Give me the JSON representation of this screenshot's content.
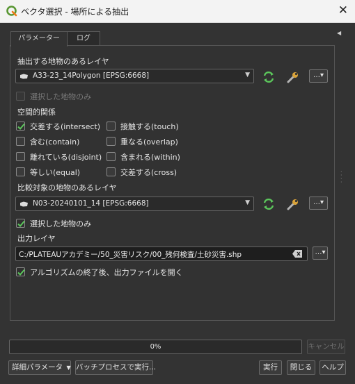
{
  "window": {
    "title": "ベクタ選択 - 場所による抽出",
    "close_glyph": "✕"
  },
  "tabs": [
    {
      "label": "パラメーター"
    },
    {
      "label": "ログ"
    }
  ],
  "params": {
    "input_layer_label": "抽出する地物のあるレイヤ",
    "input_layer_value": "A33-23_14Polygon [EPSG:6668]",
    "input_selected_only": "選択した地物のみ",
    "predicate_label": "空間的関係",
    "predicates": [
      {
        "label": "交差する(intersect)",
        "checked": true
      },
      {
        "label": "接触する(touch)",
        "checked": false
      },
      {
        "label": "含む(contain)",
        "checked": false
      },
      {
        "label": "重なる(overlap)",
        "checked": false
      },
      {
        "label": "離れている(disjoint)",
        "checked": false
      },
      {
        "label": "含まれる(within)",
        "checked": false
      },
      {
        "label": "等しい(equal)",
        "checked": false
      },
      {
        "label": "交差する(cross)",
        "checked": false
      }
    ],
    "compare_layer_label": "比較対象の地物のあるレイヤ",
    "compare_layer_value": "N03-20240101_14 [EPSG:6668]",
    "compare_selected_only": "選択した地物のみ",
    "output_label": "出力レイヤ",
    "output_value": "C:/PLATEAUアカデミー/50_災害リスク/00_残何検査/土砂災害.shp",
    "open_output": "アルゴリズムの終了後、出力ファイルを開く",
    "more_glyph": "…"
  },
  "progress": {
    "text": "0%",
    "value": 0
  },
  "buttons": {
    "cancel": "キャンセル",
    "advanced": "詳細パラメータ",
    "batch": "バッチプロセスで実行...",
    "run": "実行",
    "close": "閉じる",
    "help": "ヘルプ"
  },
  "colors": {
    "accent_green": "#4caf50",
    "check_green": "#5cc75c"
  }
}
